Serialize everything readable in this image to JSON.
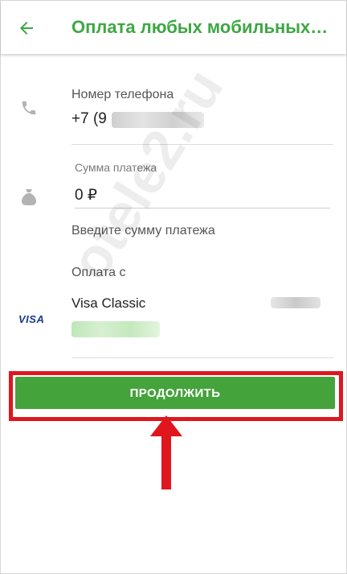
{
  "header": {
    "title": "Оплата любых мобильных…",
    "back_icon": "arrow-left-icon",
    "accent_color": "#3ea743"
  },
  "phone_field": {
    "label": "Номер телефона",
    "value": "+7 (9",
    "icon": "phone-icon"
  },
  "amount_field": {
    "label": "Сумма платежа",
    "value": "0 ₽",
    "hint": "Введите сумму платежа",
    "icon": "money-bag-icon"
  },
  "payment_source": {
    "label": "Оплата с",
    "card_name": "Visa Classic",
    "card_brand": "VISA"
  },
  "continue_button": {
    "label": "ПРОДОЛЖИТЬ",
    "color": "#45a33c",
    "highlight_color": "#e0161f"
  },
  "watermark": {
    "text": "otele2.ru"
  }
}
